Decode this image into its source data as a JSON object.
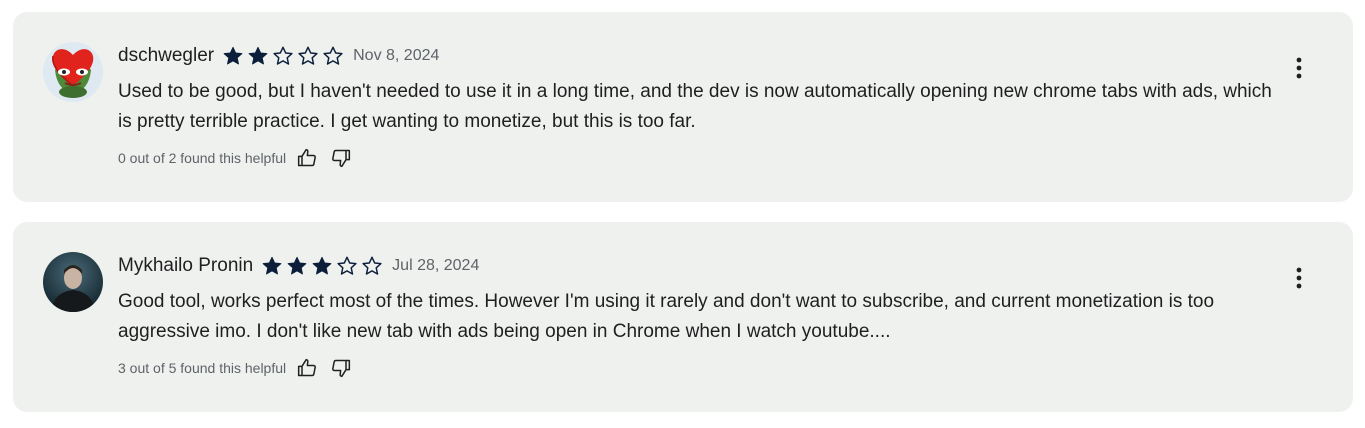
{
  "reviews": [
    {
      "author": "dschwegler",
      "rating": 2,
      "max_rating": 5,
      "date": "Nov 8, 2024",
      "text": "Used to be good, but I haven't needed to use it in a long time, and the dev is now automatically opening new chrome tabs with ads, which is pretty terrible practice. I get wanting to monetize, but this is too far.",
      "helpful": "0 out of 2 found this helpful",
      "avatar_icon": "pepe-heart-avatar"
    },
    {
      "author": "Mykhailo Pronin",
      "rating": 3,
      "max_rating": 5,
      "date": "Jul 28, 2024",
      "text": "Good tool, works perfect most of the times. However I'm using it rarely and don't want to subscribe, and current monetization is too aggressive imo. I don't like new tab with ads being open in Chrome when I watch youtube....",
      "helpful": "3 out of 5 found this helpful",
      "avatar_icon": "person-photo-avatar"
    }
  ],
  "colors": {
    "card_background": "#eff1ef",
    "star": "#0b1f3a",
    "secondary_text": "#5f6368"
  },
  "icons": {
    "filled_star": "filled-star-icon",
    "empty_star": "empty-star-icon",
    "thumbs_up": "thumbs-up-icon",
    "thumbs_down": "thumbs-down-icon",
    "more": "more-vert-icon"
  }
}
